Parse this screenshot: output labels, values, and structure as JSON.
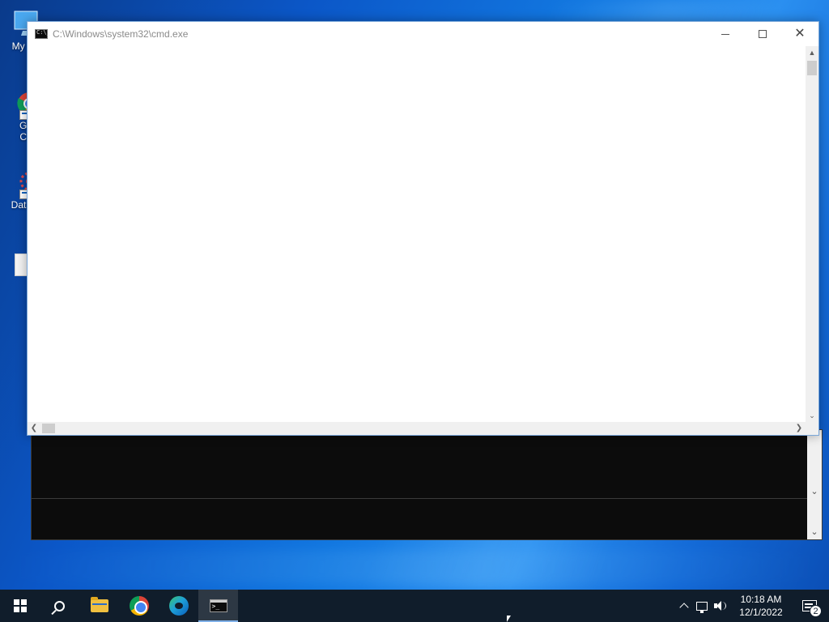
{
  "desktop": {
    "icons": [
      {
        "label": "My Co",
        "icon": "computer-icon"
      },
      {
        "label_line1": "Go",
        "label_line2": "Ch",
        "icon": "chrome-icon"
      },
      {
        "label": "DataW",
        "icon": "datawrangler-icon"
      }
    ]
  },
  "cmd_window": {
    "title": "C:\\Windows\\system32\\cmd.exe",
    "icon": "cmd-icon",
    "controls": {
      "minimize": "minimize-icon",
      "maximize": "maximize-icon",
      "close": "close-icon"
    }
  },
  "taskbar": {
    "apps": [
      {
        "name": "start",
        "icon": "windows-logo-icon"
      },
      {
        "name": "search",
        "icon": "search-icon"
      },
      {
        "name": "file-explorer",
        "icon": "folder-icon"
      },
      {
        "name": "chrome",
        "icon": "chrome-icon"
      },
      {
        "name": "edge",
        "icon": "edge-icon"
      },
      {
        "name": "command-prompt",
        "icon": "cmd-icon",
        "active": true
      }
    ],
    "tray": {
      "time": "10:18 AM",
      "date": "12/1/2022",
      "notification_count": "2"
    }
  },
  "colors": {
    "taskbar_bg": "#101d2b",
    "console_bg": "#0c0c0c",
    "desktop_accent": "#1277e0"
  }
}
